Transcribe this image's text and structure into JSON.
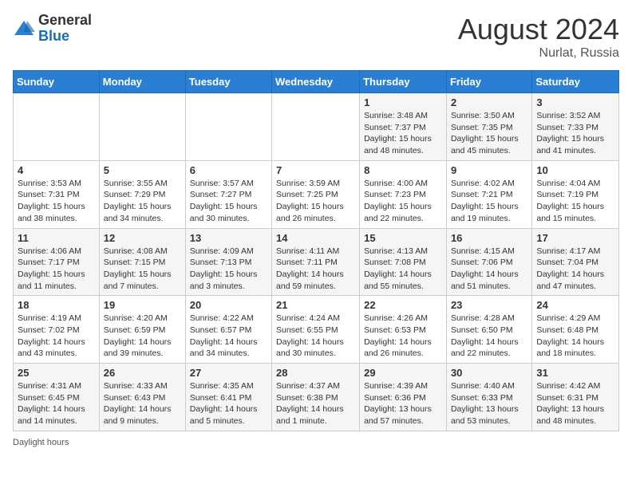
{
  "header": {
    "logo_general": "General",
    "logo_blue": "Blue",
    "month_year": "August 2024",
    "location": "Nurlat, Russia"
  },
  "days_of_week": [
    "Sunday",
    "Monday",
    "Tuesday",
    "Wednesday",
    "Thursday",
    "Friday",
    "Saturday"
  ],
  "weeks": [
    [
      {
        "day": "",
        "sunrise": "",
        "sunset": "",
        "daylight": ""
      },
      {
        "day": "",
        "sunrise": "",
        "sunset": "",
        "daylight": ""
      },
      {
        "day": "",
        "sunrise": "",
        "sunset": "",
        "daylight": ""
      },
      {
        "day": "",
        "sunrise": "",
        "sunset": "",
        "daylight": ""
      },
      {
        "day": "1",
        "sunrise": "Sunrise: 3:48 AM",
        "sunset": "Sunset: 7:37 PM",
        "daylight": "Daylight: 15 hours and 48 minutes."
      },
      {
        "day": "2",
        "sunrise": "Sunrise: 3:50 AM",
        "sunset": "Sunset: 7:35 PM",
        "daylight": "Daylight: 15 hours and 45 minutes."
      },
      {
        "day": "3",
        "sunrise": "Sunrise: 3:52 AM",
        "sunset": "Sunset: 7:33 PM",
        "daylight": "Daylight: 15 hours and 41 minutes."
      }
    ],
    [
      {
        "day": "4",
        "sunrise": "Sunrise: 3:53 AM",
        "sunset": "Sunset: 7:31 PM",
        "daylight": "Daylight: 15 hours and 38 minutes."
      },
      {
        "day": "5",
        "sunrise": "Sunrise: 3:55 AM",
        "sunset": "Sunset: 7:29 PM",
        "daylight": "Daylight: 15 hours and 34 minutes."
      },
      {
        "day": "6",
        "sunrise": "Sunrise: 3:57 AM",
        "sunset": "Sunset: 7:27 PM",
        "daylight": "Daylight: 15 hours and 30 minutes."
      },
      {
        "day": "7",
        "sunrise": "Sunrise: 3:59 AM",
        "sunset": "Sunset: 7:25 PM",
        "daylight": "Daylight: 15 hours and 26 minutes."
      },
      {
        "day": "8",
        "sunrise": "Sunrise: 4:00 AM",
        "sunset": "Sunset: 7:23 PM",
        "daylight": "Daylight: 15 hours and 22 minutes."
      },
      {
        "day": "9",
        "sunrise": "Sunrise: 4:02 AM",
        "sunset": "Sunset: 7:21 PM",
        "daylight": "Daylight: 15 hours and 19 minutes."
      },
      {
        "day": "10",
        "sunrise": "Sunrise: 4:04 AM",
        "sunset": "Sunset: 7:19 PM",
        "daylight": "Daylight: 15 hours and 15 minutes."
      }
    ],
    [
      {
        "day": "11",
        "sunrise": "Sunrise: 4:06 AM",
        "sunset": "Sunset: 7:17 PM",
        "daylight": "Daylight: 15 hours and 11 minutes."
      },
      {
        "day": "12",
        "sunrise": "Sunrise: 4:08 AM",
        "sunset": "Sunset: 7:15 PM",
        "daylight": "Daylight: 15 hours and 7 minutes."
      },
      {
        "day": "13",
        "sunrise": "Sunrise: 4:09 AM",
        "sunset": "Sunset: 7:13 PM",
        "daylight": "Daylight: 15 hours and 3 minutes."
      },
      {
        "day": "14",
        "sunrise": "Sunrise: 4:11 AM",
        "sunset": "Sunset: 7:11 PM",
        "daylight": "Daylight: 14 hours and 59 minutes."
      },
      {
        "day": "15",
        "sunrise": "Sunrise: 4:13 AM",
        "sunset": "Sunset: 7:08 PM",
        "daylight": "Daylight: 14 hours and 55 minutes."
      },
      {
        "day": "16",
        "sunrise": "Sunrise: 4:15 AM",
        "sunset": "Sunset: 7:06 PM",
        "daylight": "Daylight: 14 hours and 51 minutes."
      },
      {
        "day": "17",
        "sunrise": "Sunrise: 4:17 AM",
        "sunset": "Sunset: 7:04 PM",
        "daylight": "Daylight: 14 hours and 47 minutes."
      }
    ],
    [
      {
        "day": "18",
        "sunrise": "Sunrise: 4:19 AM",
        "sunset": "Sunset: 7:02 PM",
        "daylight": "Daylight: 14 hours and 43 minutes."
      },
      {
        "day": "19",
        "sunrise": "Sunrise: 4:20 AM",
        "sunset": "Sunset: 6:59 PM",
        "daylight": "Daylight: 14 hours and 39 minutes."
      },
      {
        "day": "20",
        "sunrise": "Sunrise: 4:22 AM",
        "sunset": "Sunset: 6:57 PM",
        "daylight": "Daylight: 14 hours and 34 minutes."
      },
      {
        "day": "21",
        "sunrise": "Sunrise: 4:24 AM",
        "sunset": "Sunset: 6:55 PM",
        "daylight": "Daylight: 14 hours and 30 minutes."
      },
      {
        "day": "22",
        "sunrise": "Sunrise: 4:26 AM",
        "sunset": "Sunset: 6:53 PM",
        "daylight": "Daylight: 14 hours and 26 minutes."
      },
      {
        "day": "23",
        "sunrise": "Sunrise: 4:28 AM",
        "sunset": "Sunset: 6:50 PM",
        "daylight": "Daylight: 14 hours and 22 minutes."
      },
      {
        "day": "24",
        "sunrise": "Sunrise: 4:29 AM",
        "sunset": "Sunset: 6:48 PM",
        "daylight": "Daylight: 14 hours and 18 minutes."
      }
    ],
    [
      {
        "day": "25",
        "sunrise": "Sunrise: 4:31 AM",
        "sunset": "Sunset: 6:45 PM",
        "daylight": "Daylight: 14 hours and 14 minutes."
      },
      {
        "day": "26",
        "sunrise": "Sunrise: 4:33 AM",
        "sunset": "Sunset: 6:43 PM",
        "daylight": "Daylight: 14 hours and 9 minutes."
      },
      {
        "day": "27",
        "sunrise": "Sunrise: 4:35 AM",
        "sunset": "Sunset: 6:41 PM",
        "daylight": "Daylight: 14 hours and 5 minutes."
      },
      {
        "day": "28",
        "sunrise": "Sunrise: 4:37 AM",
        "sunset": "Sunset: 6:38 PM",
        "daylight": "Daylight: 14 hours and 1 minute."
      },
      {
        "day": "29",
        "sunrise": "Sunrise: 4:39 AM",
        "sunset": "Sunset: 6:36 PM",
        "daylight": "Daylight: 13 hours and 57 minutes."
      },
      {
        "day": "30",
        "sunrise": "Sunrise: 4:40 AM",
        "sunset": "Sunset: 6:33 PM",
        "daylight": "Daylight: 13 hours and 53 minutes."
      },
      {
        "day": "31",
        "sunrise": "Sunrise: 4:42 AM",
        "sunset": "Sunset: 6:31 PM",
        "daylight": "Daylight: 13 hours and 48 minutes."
      }
    ]
  ],
  "footer": {
    "daylight_label": "Daylight hours"
  }
}
